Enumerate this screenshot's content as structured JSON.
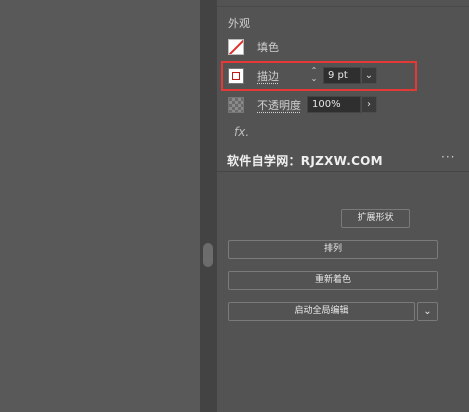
{
  "appearance": {
    "section_title": "外观",
    "fill": {
      "label": "填色",
      "icon": "fill-none-swatch-icon"
    },
    "stroke": {
      "label": "描边",
      "weight_value": "9 pt",
      "icon": "stroke-swatch-icon"
    },
    "opacity": {
      "label": "不透明度",
      "value": "100%",
      "icon": "transparency-checker-icon"
    },
    "fx_label": "fx."
  },
  "watermark": "软件自学网：RJZXW.COM",
  "more_icon": "···",
  "actions": {
    "expand_shape": "扩展形状",
    "arrange": "排列",
    "recolor": "重新着色",
    "global_edit": "启动全局编辑"
  },
  "colors": {
    "highlight": "#e53935",
    "panel_bg": "#535353",
    "field_bg": "#2f2f2f"
  }
}
